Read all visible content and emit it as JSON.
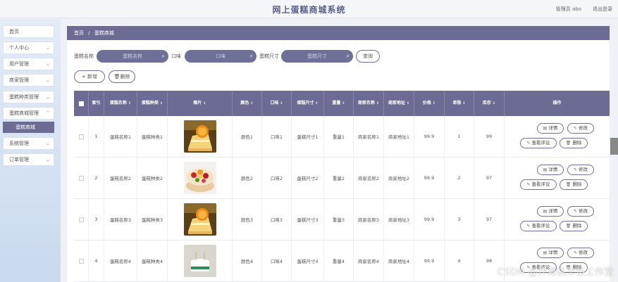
{
  "header": {
    "title": "网上蛋糕商城系统",
    "admin": "管理员 abo",
    "logout": "退出登录"
  },
  "sidebar": {
    "items": [
      {
        "label": "首页",
        "chevron": false
      },
      {
        "label": "个人中心",
        "chevron": true
      },
      {
        "label": "用户管理",
        "chevron": true
      },
      {
        "label": "商家管理",
        "chevron": true
      },
      {
        "label": "蛋糕种类管理",
        "chevron": true
      },
      {
        "label": "蛋糕商城管理",
        "chevron": true
      },
      {
        "label": "系统管理",
        "chevron": true
      },
      {
        "label": "订单管理",
        "chevron": true
      }
    ],
    "sub_item": "蛋糕商城"
  },
  "breadcrumb": {
    "home": "首页",
    "sep": "/",
    "current": "蛋糕商城"
  },
  "search": {
    "name_label": "蛋糕名称",
    "name_placeholder": "蛋糕名称",
    "taste_label": "口味",
    "taste_placeholder": "口味",
    "size_label": "蛋糕尺寸",
    "size_placeholder": "蛋糕尺寸",
    "query_button": "查询"
  },
  "toolbar": {
    "add_button": "+ 新增",
    "delete_button": "删除"
  },
  "table": {
    "headers": [
      "索引",
      "蛋糕名称",
      "蛋糕种类",
      "图片",
      "颜色",
      "口味",
      "蛋糕尺寸",
      "重量",
      "商家名称",
      "商家地址",
      "价格",
      "单限",
      "库存",
      "操作"
    ],
    "actions": {
      "detail": "详情",
      "edit": "修改",
      "review": "查看评论",
      "delete": "删除"
    },
    "rows": [
      {
        "index": "1",
        "name": "蛋糕名称1",
        "kind": "蛋糕种类1",
        "image": "orange-cake",
        "color": "颜色1",
        "taste": "口味1",
        "size": "蛋糕尺寸1",
        "weight": "重量1",
        "shop": "商家名称1",
        "address": "商家地址1",
        "price": "99.9",
        "limit": "1",
        "stock": "99"
      },
      {
        "index": "2",
        "name": "蛋糕名称2",
        "kind": "蛋糕种类2",
        "image": "fruit-cake",
        "color": "颜色2",
        "taste": "口味2",
        "size": "蛋糕尺寸2",
        "weight": "重量2",
        "shop": "商家名称2",
        "address": "商家地址2",
        "price": "99.9",
        "limit": "2",
        "stock": "97"
      },
      {
        "index": "3",
        "name": "蛋糕名称3",
        "kind": "蛋糕种类3",
        "image": "orange-cake",
        "color": "颜色3",
        "taste": "口味3",
        "size": "蛋糕尺寸3",
        "weight": "重量3",
        "shop": "商家名称3",
        "address": "商家地址3",
        "price": "99.9",
        "limit": "3",
        "stock": "97"
      },
      {
        "index": "4",
        "name": "蛋糕名称4",
        "kind": "蛋糕种类4",
        "image": "white-cake",
        "color": "颜色4",
        "taste": "口味4",
        "size": "蛋糕尺寸4",
        "weight": "重量4",
        "shop": "商家名称4",
        "address": "商家地址4",
        "price": "99.9",
        "limit": "4",
        "stock": "98"
      }
    ]
  },
  "watermark": "CSDN @计算机毕设工作室",
  "colors": {
    "primary": "#6b6b93",
    "pill": "#6f6f98",
    "title": "#5a5f86"
  }
}
